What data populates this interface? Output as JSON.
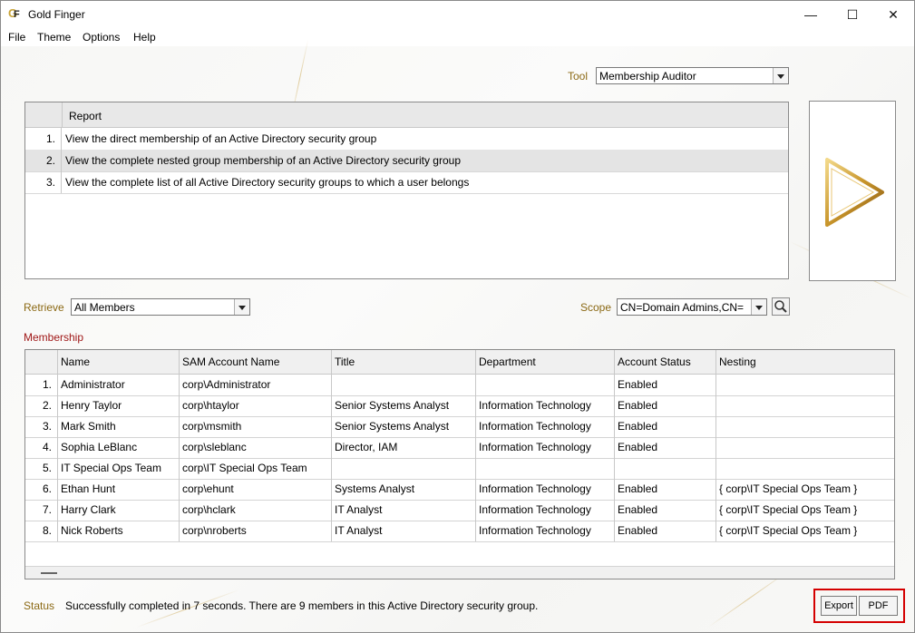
{
  "window": {
    "title": "Gold Finger",
    "minimize": "—",
    "maximize": "☐",
    "close": "✕"
  },
  "menu": [
    "File",
    "Theme",
    "Options",
    "Help"
  ],
  "tool": {
    "label": "Tool",
    "value": "Membership Auditor"
  },
  "reports": {
    "header": "Report",
    "items": [
      {
        "num": "1.",
        "label": "View the direct membership of an Active Directory security group"
      },
      {
        "num": "2.",
        "label": "View the complete nested group membership of an Active Directory security group"
      },
      {
        "num": "3.",
        "label": "View the complete list of all Active Directory security groups to which a user belongs"
      }
    ],
    "selected_index": 1
  },
  "retrieve": {
    "label": "Retrieve",
    "value": "All Members"
  },
  "scope": {
    "label": "Scope",
    "value": "CN=Domain Admins,CN="
  },
  "membership": {
    "label": "Membership",
    "columns": [
      "Name",
      "SAM Account Name",
      "Title",
      "Department",
      "Account Status",
      "Nesting"
    ],
    "rows": [
      {
        "num": "1.",
        "name": "Administrator",
        "sam": "corp\\Administrator",
        "title": "",
        "department": "",
        "status": "Enabled",
        "nesting": ""
      },
      {
        "num": "2.",
        "name": "Henry Taylor",
        "sam": "corp\\htaylor",
        "title": "Senior Systems Analyst",
        "department": "Information Technology",
        "status": "Enabled",
        "nesting": ""
      },
      {
        "num": "3.",
        "name": "Mark Smith",
        "sam": "corp\\msmith",
        "title": "Senior Systems Analyst",
        "department": "Information Technology",
        "status": "Enabled",
        "nesting": ""
      },
      {
        "num": "4.",
        "name": "Sophia LeBlanc",
        "sam": "corp\\sleblanc",
        "title": "Director, IAM",
        "department": "Information Technology",
        "status": "Enabled",
        "nesting": ""
      },
      {
        "num": "5.",
        "name": "IT Special Ops Team",
        "sam": "corp\\IT Special Ops Team",
        "title": "",
        "department": "",
        "status": "",
        "nesting": ""
      },
      {
        "num": "6.",
        "name": "Ethan Hunt",
        "sam": "corp\\ehunt",
        "title": "Systems Analyst",
        "department": "Information Technology",
        "status": "Enabled",
        "nesting": "{ corp\\IT Special Ops Team }"
      },
      {
        "num": "7.",
        "name": "Harry Clark",
        "sam": "corp\\hclark",
        "title": "IT Analyst",
        "department": "Information Technology",
        "status": "Enabled",
        "nesting": "{ corp\\IT Special Ops Team }"
      },
      {
        "num": "8.",
        "name": "Nick Roberts",
        "sam": "corp\\nroberts",
        "title": "IT Analyst",
        "department": "Information Technology",
        "status": "Enabled",
        "nesting": "{ corp\\IT Special Ops Team }"
      }
    ]
  },
  "status": {
    "label": "Status",
    "text": "Successfully completed in 7 seconds.  There are 9 members in this Active Directory security group."
  },
  "buttons": {
    "export": "Export",
    "pdf": "PDF"
  },
  "colors": {
    "gold_label": "#8b6914",
    "red_label": "#a01818",
    "highlight": "#d40000"
  }
}
